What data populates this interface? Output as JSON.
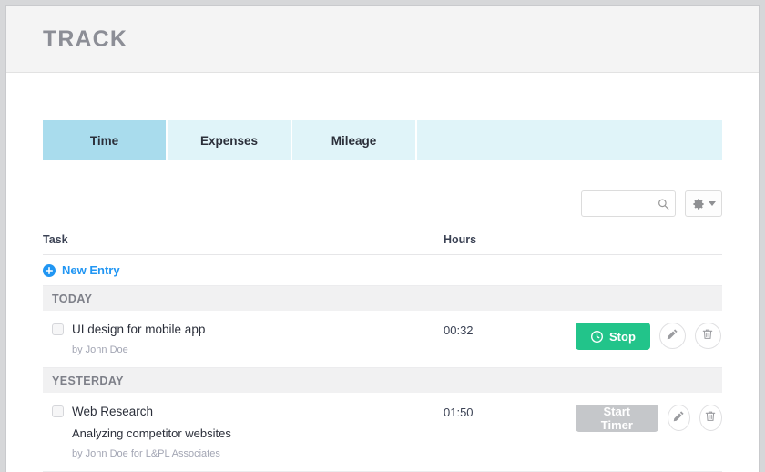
{
  "header": {
    "title": "TRACK"
  },
  "tabs": [
    {
      "label": "Time",
      "active": true
    },
    {
      "label": "Expenses",
      "active": false
    },
    {
      "label": "Mileage",
      "active": false
    }
  ],
  "toolbar": {
    "search": {
      "value": "",
      "placeholder": "",
      "icon": "search-icon"
    },
    "settings": {
      "icon": "gear-icon",
      "caret": "chevron-down-icon"
    }
  },
  "table": {
    "columns": {
      "task": "Task",
      "hours": "Hours"
    },
    "new_entry": {
      "label": "New Entry",
      "icon": "plus-circle-icon"
    },
    "groups": [
      {
        "label": "TODAY",
        "entries": [
          {
            "title": "UI design for mobile app",
            "note": "",
            "meta": "by John Doe",
            "hours": "00:32",
            "timer": {
              "label": "Stop",
              "state": "running",
              "icon": "clock-icon"
            },
            "edit_icon": "pencil-icon",
            "delete_icon": "trash-icon"
          }
        ]
      },
      {
        "label": "YESTERDAY",
        "entries": [
          {
            "title": "Web Research",
            "note": "Analyzing competitor websites",
            "meta": "by John Doe for L&PL Associates",
            "hours": "01:50",
            "timer": {
              "label": "Start Timer",
              "state": "stopped",
              "icon": ""
            },
            "edit_icon": "pencil-icon",
            "delete_icon": "trash-icon"
          }
        ]
      }
    ]
  },
  "colors": {
    "tab_active": "#a9dced",
    "tab_inactive": "#e0f4f9",
    "accent_link": "#2196f3",
    "timer_running": "#22c48a",
    "timer_stopped": "#c5c7ca",
    "header_band": "#f4f4f4",
    "title_text": "#8c8e96"
  }
}
